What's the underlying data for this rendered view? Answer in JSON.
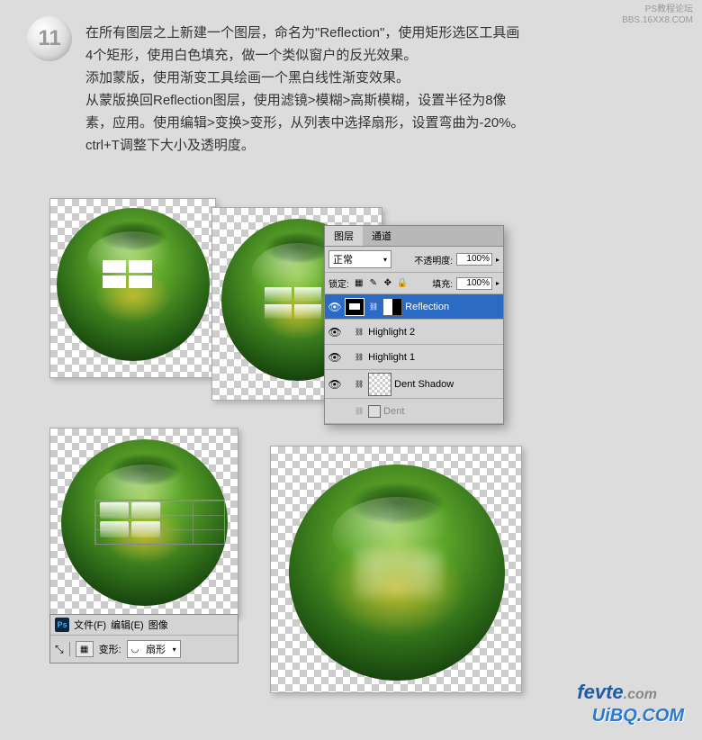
{
  "top_watermark": {
    "line1": "PS教程论坛",
    "line2": "BBS.16XX8.COM"
  },
  "step": {
    "number": "11",
    "text": "在所有图层之上新建一个图层，命名为\"Reflection\"，使用矩形选区工具画4个矩形，使用白色填充，做一个类似窗户的反光效果。\n添加蒙版，使用渐变工具绘画一个黑白线性渐变效果。\n从蒙版换回Reflection图层，使用滤镜>模糊>高斯模糊，设置半径为8像素，应用。使用编辑>变换>变形，从列表中选择扇形，设置弯曲为-20%。ctrl+T调整下大小及透明度。"
  },
  "layers_panel": {
    "tabs": {
      "active": "图层",
      "inactive": "通道"
    },
    "blend_mode": "正常",
    "opacity_label": "不透明度:",
    "opacity_value": "100%",
    "lock_label": "锁定:",
    "fill_label": "填充:",
    "fill_value": "100%",
    "layers": [
      {
        "name": "Reflection",
        "selected": true
      },
      {
        "name": "Highlight 2",
        "selected": false
      },
      {
        "name": "Highlight 1",
        "selected": false
      },
      {
        "name": "Dent Shadow",
        "selected": false
      },
      {
        "name": "Dent",
        "selected": false
      }
    ]
  },
  "options_bar": {
    "menus": [
      "文件(F)",
      "编辑(E)",
      "图像"
    ],
    "warp_label": "变形:",
    "warp_value": "扇形"
  },
  "watermarks": {
    "fevte": "fevte",
    "fevte_suffix": ".com",
    "uibq": "UiBQ.COM"
  }
}
